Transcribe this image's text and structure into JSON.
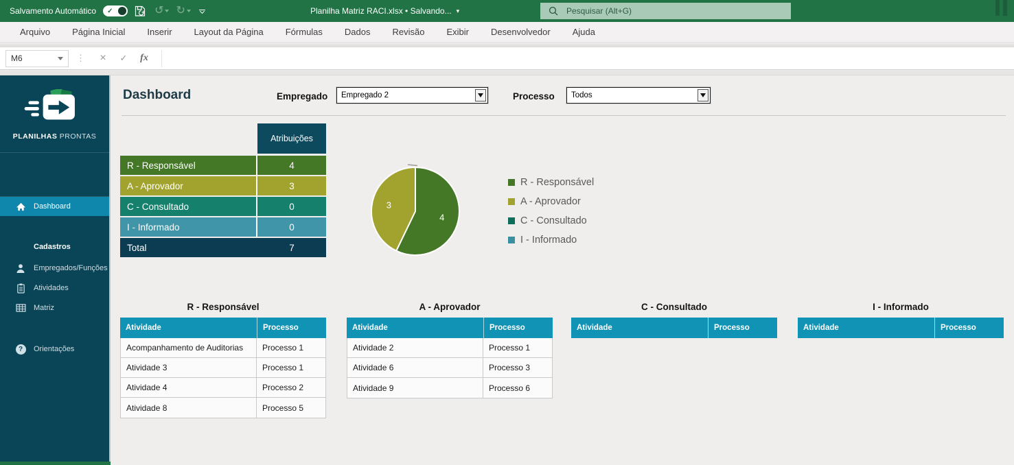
{
  "titlebar": {
    "autosave_label": "Salvamento Automático",
    "document_title": "Planilha Matriz RACI.xlsx • Salvando...",
    "search_placeholder": "Pesquisar (Alt+G)"
  },
  "ribbon": {
    "tabs": [
      "Arquivo",
      "Página Inicial",
      "Inserir",
      "Layout da Página",
      "Fórmulas",
      "Dados",
      "Revisão",
      "Exibir",
      "Desenvolvedor",
      "Ajuda"
    ]
  },
  "formula_bar": {
    "cell_ref": "M6"
  },
  "icons": {
    "undo": "↺",
    "redo": "↻",
    "caret_down": "▾",
    "check": "✓",
    "close": "×",
    "dots": "⋮",
    "fx": "fx",
    "question": "?"
  },
  "sidebar": {
    "brand_bold": "PLANILHAS",
    "brand_light": " PRONTAS",
    "items": [
      {
        "label": "Dashboard"
      },
      {
        "label": "Cadastros"
      },
      {
        "label": "Empregados/Funções"
      },
      {
        "label": "Atividades"
      },
      {
        "label": "Matriz"
      },
      {
        "label": "Orientações"
      }
    ]
  },
  "main": {
    "title": "Dashboard",
    "filters": {
      "empregado_label": "Empregado",
      "empregado_value": "Empregado 2",
      "processo_label": "Processo",
      "processo_value": "Todos"
    },
    "summary": {
      "header": "Atribuições",
      "rows": [
        {
          "label": "R - Responsável",
          "value": "4",
          "color": "#447827"
        },
        {
          "label": "A - Aprovador",
          "value": "3",
          "color": "#a2a32e"
        },
        {
          "label": "C - Consultado",
          "value": "0",
          "color": "#15806c"
        },
        {
          "label": "I - Informado",
          "value": "0",
          "color": "#4195a8"
        }
      ],
      "total": {
        "label": "Total",
        "value": "7",
        "color": "#0c3c51"
      }
    },
    "tables": [
      {
        "title": "R - Responsável",
        "headers": [
          "Atividade",
          "Processo"
        ],
        "rows": [
          [
            "Acompanhamento de Auditorias",
            "Processo 1"
          ],
          [
            "Atividade 3",
            "Processo 1"
          ],
          [
            "Atividade 4",
            "Processo 2"
          ],
          [
            "Atividade 8",
            "Processo 5"
          ]
        ]
      },
      {
        "title": "A - Aprovador",
        "headers": [
          "Atividade",
          "Processo"
        ],
        "rows": [
          [
            "Atividade 2",
            "Processo 1"
          ],
          [
            "Atividade 6",
            "Processo 3"
          ],
          [
            "Atividade 9",
            "Processo 6"
          ]
        ]
      },
      {
        "title": "C - Consultado",
        "headers": [
          "Atividade",
          "Processo"
        ],
        "rows": []
      },
      {
        "title": "I - Informado",
        "headers": [
          "Atividade",
          "Processo"
        ],
        "rows": []
      }
    ]
  },
  "chart_data": {
    "type": "pie",
    "title": "",
    "categories": [
      "R - Responsável",
      "A - Aprovador",
      "C - Consultado",
      "I - Informado"
    ],
    "values": [
      4,
      3,
      0,
      0
    ],
    "colors": [
      "#447827",
      "#a2a32e",
      "#0e6e5c",
      "#3a8fa0"
    ],
    "legend_position": "right",
    "data_labels": true,
    "start_angle_deg": 0,
    "direction": "clockwise"
  }
}
